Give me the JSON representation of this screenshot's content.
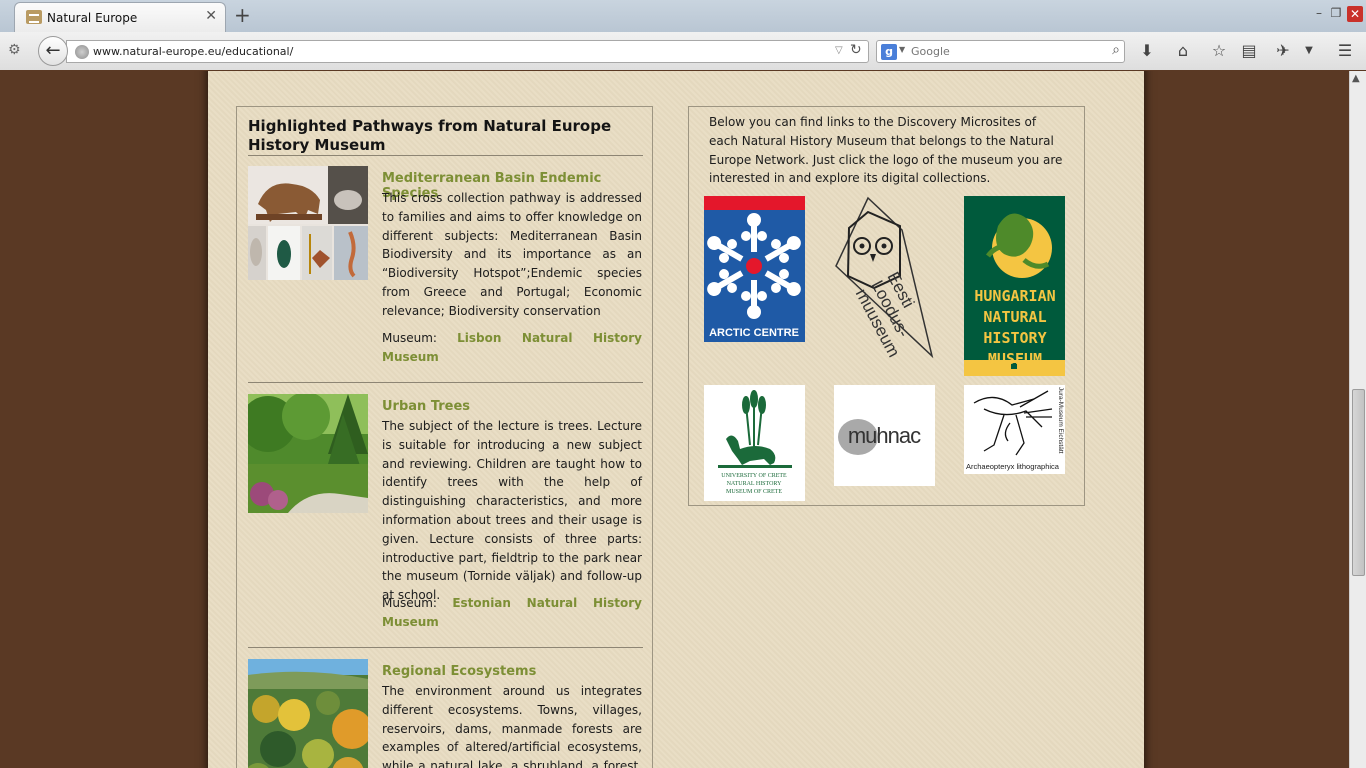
{
  "browser": {
    "tab_title": "Natural Europe",
    "url": "www.natural-europe.eu/educational/",
    "search_placeholder": "Google"
  },
  "left_panel": {
    "heading": "Highlighted Pathways from Natural Europe History Museum",
    "pathways": [
      {
        "title": "Mediterranean Basin Endemic Species",
        "description": "This cross collection pathway is addressed to families and aims to offer knowledge on different subjects: Mediterranean Basin Biodiversity and its importance as an “Biodiversity Hotspot”;Endemic species from Greece and Portugal; Economic relevance; Biodiversity conservation",
        "museum_label": "Museum:",
        "museum_name_1": "Lisbon Natural History",
        "museum_name_2": "Museum"
      },
      {
        "title": "Urban Trees",
        "description": "The subject of the lecture is trees. Lecture is suitable for introducing a new subject and reviewing. Children are taught how to identify trees with the help of distinguishing characteristics, and more information about trees and their usage is given. Lecture consists of three parts: introductive part, fieldtrip to the park near the museum (Tornide väljak) and follow-up at school.",
        "museum_label": "Museum:",
        "museum_name_1": "Estonian Natural History",
        "museum_name_2": "Museum"
      },
      {
        "title": "Regional Ecosystems",
        "description": "The environment around us integrates different ecosystems. Towns, villages, reservoirs, dams, manmade forests are examples of altered/artificial ecosystems, while a natural lake, a shrubland, a forest, a"
      }
    ]
  },
  "right_panel": {
    "intro": "Below you can find links to the Discovery Microsites of each Natural History Museum that belongs to the Natural Europe Network. Just click the logo of the museum you are interested in and explore its digital collections.",
    "logos": {
      "arctic": "ARCTIC CENTRE",
      "eesti_1": "Eesti",
      "eesti_2": "Loodus-",
      "eesti_3": "muuseum",
      "hungarian_1": "HUNGARIAN",
      "hungarian_2": "NATURAL",
      "hungarian_3": "HISTORY",
      "hungarian_4": "MUSEUM",
      "crete_1": "UNIVERSITY OF CRETE",
      "crete_2": "NATURAL HISTORY",
      "crete_3": "MUSEUM OF CRETE",
      "muhnac": "muhnac",
      "jura_side": "Jura-Museum Eichstätt",
      "jura_caption": "Archaeopteryx lithographica"
    }
  },
  "colors": {
    "page_bg": "#5a3924",
    "paper": "#e8dcc2",
    "link_green": "#7d8f35",
    "arctic_blue": "#1f5aa6",
    "hungarian_green": "#005a3c",
    "hungarian_yellow": "#f4c542"
  }
}
